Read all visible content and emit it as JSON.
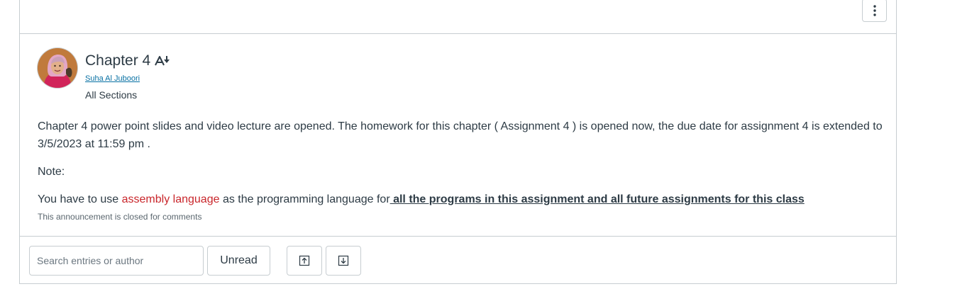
{
  "header": {
    "options_icon": "kebab-vertical-icon"
  },
  "post": {
    "avatar_icon": "user-avatar",
    "title": "Chapter 4",
    "immersive_reader_icon": "immersive-reader-icon",
    "author": "Suha Al Juboori",
    "sections": "All Sections",
    "body": {
      "p1": "Chapter 4 power point slides and video lecture are opened. The homework for this chapter ( Assignment 4  ) is opened now, the due date for assignment 4 is extended to 3/5/2023 at 11:59 pm .",
      "p2": "Note:",
      "p3_prefix": "You have to use ",
      "p3_red": "assembly language",
      "p3_middle": " as the programming language for",
      "p3_link": " all the programs in this assignment and all future assignments for this class"
    },
    "comments_closed": "This announcement is closed for comments"
  },
  "toolbar": {
    "search_placeholder": "Search entries or author",
    "unread_label": "Unread",
    "collapse_icon": "collapse-replies-icon",
    "expand_icon": "expand-replies-icon"
  },
  "colors": {
    "text": "#2d3b45",
    "link": "#0770a3",
    "highlight_red": "#c9262b",
    "border": "#c7cdd1"
  }
}
